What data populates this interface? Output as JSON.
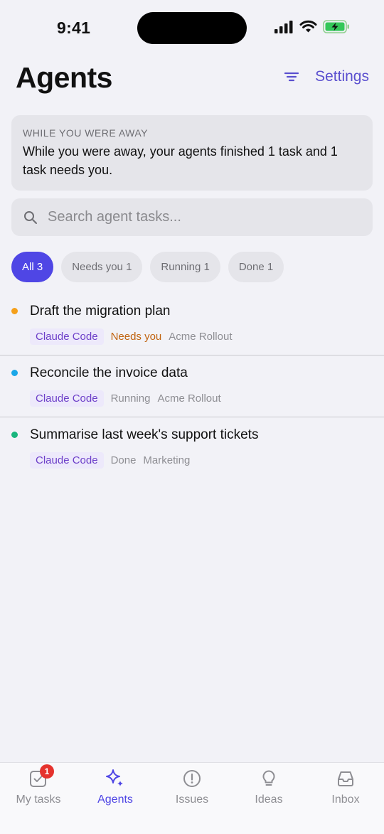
{
  "status_bar": {
    "time": "9:41"
  },
  "header": {
    "title": "Agents",
    "settings_label": "Settings"
  },
  "away": {
    "label": "WHILE YOU WERE AWAY",
    "text": "While you were away, your agents finished 1 task and 1 task needs you."
  },
  "search": {
    "placeholder": "Search agent tasks..."
  },
  "chips": [
    {
      "label": "All 3",
      "active": true
    },
    {
      "label": "Needs you 1",
      "active": false
    },
    {
      "label": "Running 1",
      "active": false
    },
    {
      "label": "Done 1",
      "active": false
    }
  ],
  "tasks": [
    {
      "title": "Draft the migration plan",
      "tag": "Claude Code",
      "status": "Needs you",
      "project": "Acme Rollout",
      "dot_color": "#f5a01a",
      "status_color": "#c0630f"
    },
    {
      "title": "Reconcile the invoice data",
      "tag": "Claude Code",
      "status": "Running",
      "project": "Acme Rollout",
      "dot_color": "#1aa7e8",
      "status_color": "#8e8e93"
    },
    {
      "title": "Summarise last week's support tickets",
      "tag": "Claude Code",
      "status": "Done",
      "project": "Marketing",
      "dot_color": "#19b67d",
      "status_color": "#8e8e93"
    }
  ],
  "tab_bar": {
    "items": [
      {
        "label": "My tasks",
        "icon": "checkbox-icon",
        "badge": "1"
      },
      {
        "label": "Agents",
        "icon": "sparkle-icon",
        "active": true
      },
      {
        "label": "Issues",
        "icon": "alert-circle-icon"
      },
      {
        "label": "Ideas",
        "icon": "lightbulb-icon"
      },
      {
        "label": "Inbox",
        "icon": "inbox-icon"
      }
    ]
  },
  "colors": {
    "accent": "#4f46e5",
    "link": "#5a4fcf",
    "background": "#f2f2f7"
  }
}
